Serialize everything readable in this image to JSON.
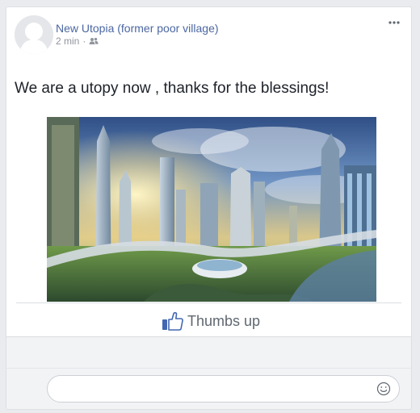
{
  "post": {
    "author": "New Utopia (former poor village)",
    "timestamp": "2 min",
    "separator": "·",
    "audience_icon": "friends-icon",
    "menu_icon": "more-options-icon",
    "text": "We are a utopy now , thanks for the blessings!",
    "image_subject": "futuristic city illustration"
  },
  "actions": {
    "like_icon": "thumbs-up-icon",
    "like_label": "Thumbs up"
  },
  "comment": {
    "value": "",
    "placeholder": "",
    "emoji_icon": "smiley-icon"
  },
  "colors": {
    "link": "#4b67a1",
    "like_blue": "#4267b2",
    "background": "#e9ebee",
    "card": "#ffffff"
  }
}
